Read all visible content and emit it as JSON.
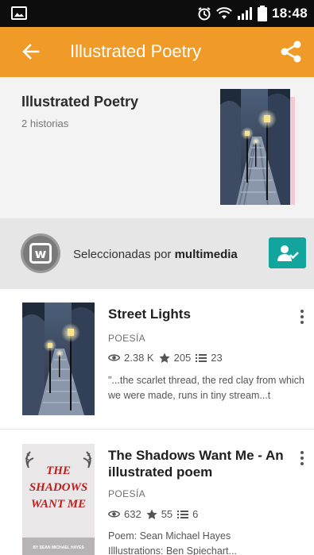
{
  "status_bar": {
    "time": "18:48",
    "icons": [
      "image-notification-icon",
      "alarm-icon",
      "wifi-icon",
      "signal-icon",
      "battery-icon"
    ]
  },
  "app_bar": {
    "title": "Illustrated Poetry",
    "back_icon": "arrow-left-icon",
    "share_icon": "share-icon",
    "color": "#f09a28"
  },
  "reading_list": {
    "title": "Illustrated Poetry",
    "count": "2 historias"
  },
  "curator": {
    "prefix": "Seleccionadas por ",
    "name": "multimedia",
    "logo_letter": "w",
    "follow_icon": "follow-user-icon",
    "follow_color": "#12a59e"
  },
  "stories": [
    {
      "title": "Street Lights",
      "genre": "POESÍA",
      "reads": "2.38 K",
      "votes": "205",
      "parts": "23",
      "description": "\"...the scarlet thread, the red clay from which we were made, runs in tiny stream...t"
    },
    {
      "title": "The Shadows Want Me - An illustrated poem",
      "genre": "POESÍA",
      "reads": "632",
      "votes": "55",
      "parts": "6",
      "description_line1": "Poem: Sean Michael Hayes",
      "description_line2": "Illlustrations: Ben Spiechart...",
      "cover_title_1": "THE",
      "cover_title_2": "SHADOWS",
      "cover_title_3": "WANT ME",
      "cover_byline": "BY SEAN MICHAEL HAYES"
    }
  ]
}
